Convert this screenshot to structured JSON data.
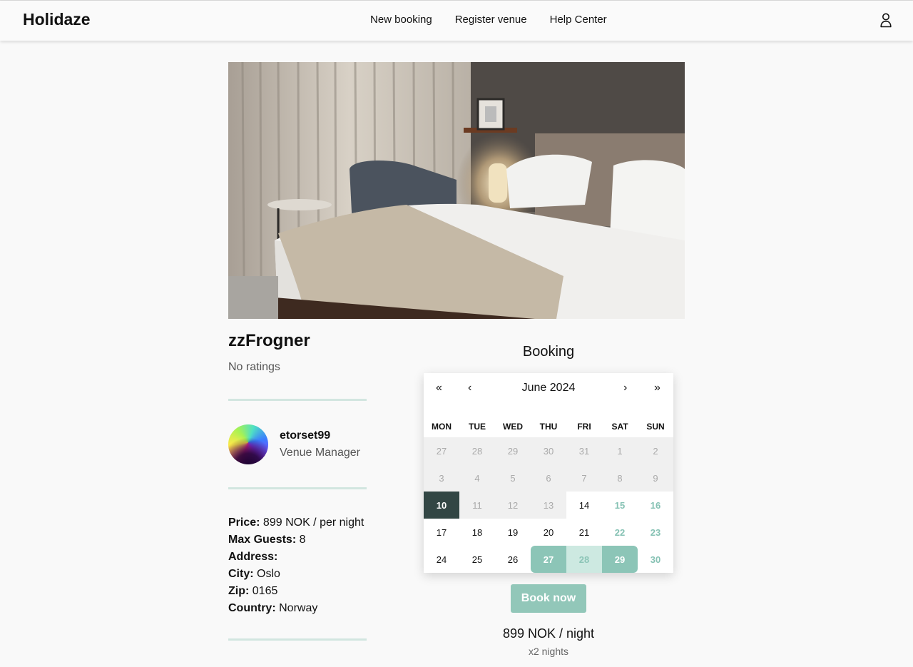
{
  "header": {
    "logo": "Holidaze",
    "nav": [
      "New booking",
      "Register venue",
      "Help Center"
    ]
  },
  "venue": {
    "name": "zzFrogner",
    "ratings": "No ratings",
    "manager": {
      "name": "etorset99",
      "role": "Venue Manager"
    },
    "details": [
      {
        "label": "Price:",
        "value": "899 NOK / per night"
      },
      {
        "label": "Max Guests:",
        "value": "8"
      },
      {
        "label": "Address:",
        "value": ""
      },
      {
        "label": "City:",
        "value": "Oslo"
      },
      {
        "label": "Zip:",
        "value": "0165"
      },
      {
        "label": "Country:",
        "value": "Norway"
      }
    ]
  },
  "booking": {
    "heading": "Booking",
    "calendar": {
      "nav": {
        "prev_year": "«",
        "prev_month": "‹",
        "month_label": "June 2024",
        "next_month": "›",
        "next_year": "»"
      },
      "weekdays": [
        "MON",
        "TUE",
        "WED",
        "THU",
        "FRI",
        "SAT",
        "SUN"
      ],
      "days": [
        {
          "d": "27",
          "s": "disabled"
        },
        {
          "d": "28",
          "s": "disabled"
        },
        {
          "d": "29",
          "s": "disabled"
        },
        {
          "d": "30",
          "s": "disabled"
        },
        {
          "d": "31",
          "s": "disabled"
        },
        {
          "d": "1",
          "s": "disabled"
        },
        {
          "d": "2",
          "s": "disabled"
        },
        {
          "d": "3",
          "s": "disabled"
        },
        {
          "d": "4",
          "s": "disabled"
        },
        {
          "d": "5",
          "s": "disabled"
        },
        {
          "d": "6",
          "s": "disabled"
        },
        {
          "d": "7",
          "s": "disabled"
        },
        {
          "d": "8",
          "s": "disabled"
        },
        {
          "d": "9",
          "s": "disabled"
        },
        {
          "d": "10",
          "s": "today"
        },
        {
          "d": "11",
          "s": "disabled"
        },
        {
          "d": "12",
          "s": "disabled"
        },
        {
          "d": "13",
          "s": "disabled"
        },
        {
          "d": "14",
          "s": ""
        },
        {
          "d": "15",
          "s": "weekend"
        },
        {
          "d": "16",
          "s": "weekend"
        },
        {
          "d": "17",
          "s": ""
        },
        {
          "d": "18",
          "s": ""
        },
        {
          "d": "19",
          "s": ""
        },
        {
          "d": "20",
          "s": ""
        },
        {
          "d": "21",
          "s": ""
        },
        {
          "d": "22",
          "s": "weekend"
        },
        {
          "d": "23",
          "s": "weekend"
        },
        {
          "d": "24",
          "s": ""
        },
        {
          "d": "25",
          "s": ""
        },
        {
          "d": "26",
          "s": ""
        },
        {
          "d": "27",
          "s": "range-start"
        },
        {
          "d": "28",
          "s": "range-mid"
        },
        {
          "d": "29",
          "s": "range-end"
        },
        {
          "d": "30",
          "s": "weekend"
        }
      ]
    },
    "book_button": "Book now",
    "price_per_night": "899 NOK / night",
    "nights": "x2 nights"
  }
}
